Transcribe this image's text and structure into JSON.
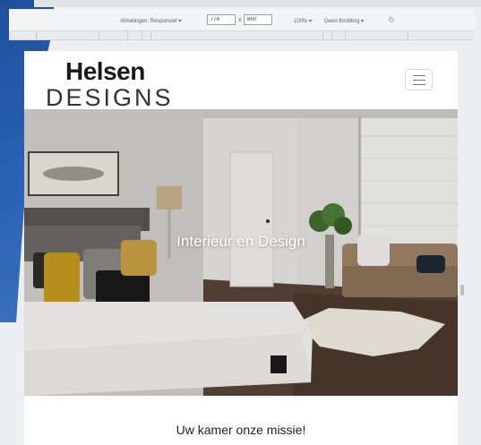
{
  "devtools": {
    "dimensions_label": "Afmetingen: Responsief ▾",
    "width_value": "774",
    "height_value": "850",
    "times": "x",
    "zoom": "100% ▾",
    "throttling": "Geen throttling ▾",
    "rotate_icon": "rotate-icon"
  },
  "site": {
    "logo_top": "Helsen",
    "logo_bottom": "DESIGNS",
    "menu_icon": "hamburger-icon",
    "hero_title": "Interieur en Design",
    "mission_heading": "Uw kamer onze missie!"
  },
  "colors": {
    "backdrop_blue": "#2a62b4",
    "hero_text": "#ffffff",
    "logo_text": "#1a1a1a"
  }
}
